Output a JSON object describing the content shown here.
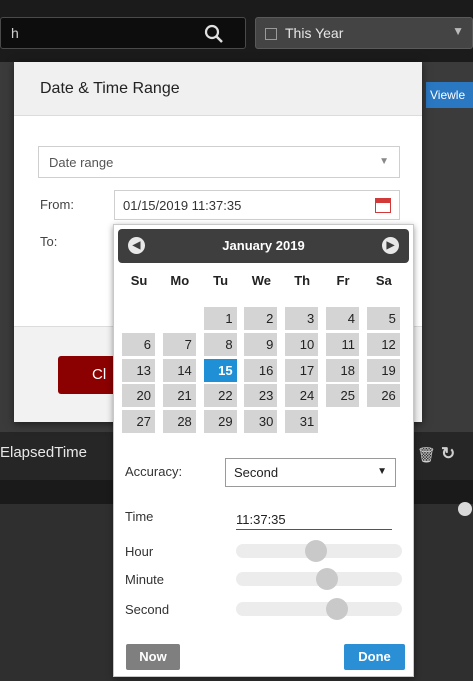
{
  "background": {
    "search_text": "h",
    "period_select": "This Year",
    "viewlet_button": "Viewle",
    "column_label": "ElapsedTime"
  },
  "dialog": {
    "title": "Date & Time Range",
    "range_select": "Date range",
    "from_label": "From:",
    "from_value": "01/15/2019 11:37:35",
    "to_label": "To:",
    "close_button": "Cl"
  },
  "picker": {
    "month_title": "January 2019",
    "weekdays": [
      "Su",
      "Mo",
      "Tu",
      "We",
      "Th",
      "Fr",
      "Sa"
    ],
    "first_weekday_index": 2,
    "days_in_month": 31,
    "selected_day": 15,
    "accuracy_label": "Accuracy:",
    "accuracy_value": "Second",
    "time_label": "Time",
    "time_value": "11:37:35",
    "hour_label": "Hour",
    "minute_label": "Minute",
    "second_label": "Second",
    "hour_value": 11,
    "minute_value": 37,
    "second_value": 35,
    "now_button": "Now",
    "done_button": "Done"
  },
  "colors": {
    "accent_blue": "#1f8fd6",
    "close_red": "#8b0000"
  }
}
